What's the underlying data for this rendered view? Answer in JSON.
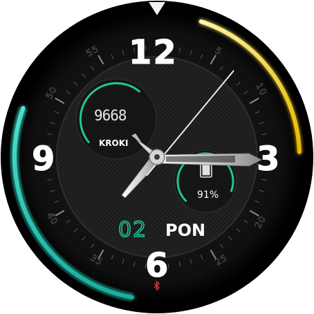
{
  "watch_face": {
    "hour_markers": [
      "12",
      "3",
      "6",
      "9"
    ],
    "minute_markers": {
      "m5": "5",
      "m10": "10",
      "m20": "20",
      "m25": "25",
      "m35": "35",
      "m40": "40",
      "m50": "50",
      "m55": "55"
    },
    "steps": {
      "value": "9668",
      "label": "KROKI"
    },
    "battery": {
      "value": "91%",
      "level": 0.91
    },
    "date": {
      "day": "02",
      "weekday": "PON"
    },
    "top_indicator_icon": "triangle-pointer-icon",
    "bluetooth_icon": "bluetooth-icon",
    "colors": {
      "accent_green": "#1fc79a",
      "ring_yellow": "#e6c414",
      "ring_teal": "#19d2c2",
      "bluetooth_red": "#e53935",
      "dial": "#1c1c1c"
    }
  }
}
